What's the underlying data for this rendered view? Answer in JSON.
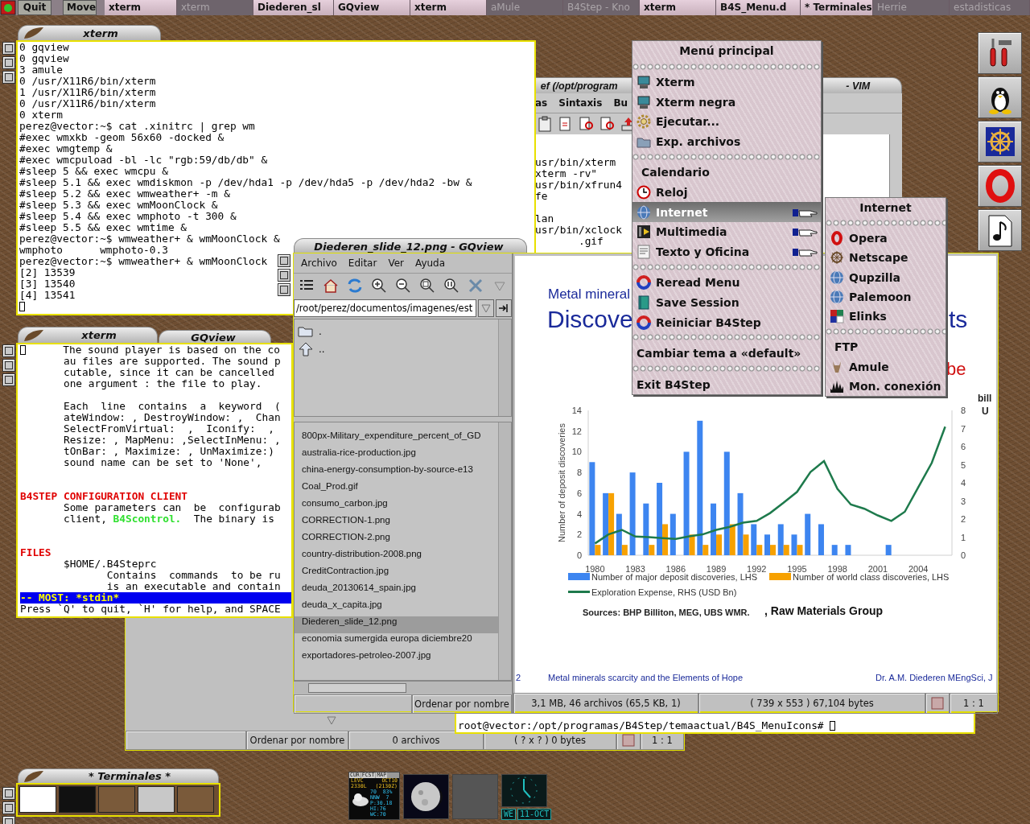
{
  "taskbar": {
    "buttons": [
      "Quit",
      "Move"
    ],
    "tasks": [
      {
        "label": "xterm",
        "iconified": false
      },
      {
        "label": "xterm",
        "iconified": true
      },
      {
        "label": "Diederen_sl",
        "iconified": false
      },
      {
        "label": "GQview",
        "iconified": false
      },
      {
        "label": "xterm",
        "iconified": false
      },
      {
        "label": "aMule",
        "iconified": true
      },
      {
        "label": "B4Step - Kno",
        "iconified": true
      },
      {
        "label": "xterm",
        "iconified": false
      },
      {
        "label": "B4S_Menu.d",
        "iconified": false
      },
      {
        "label": "* Terminales",
        "iconified": false
      },
      {
        "label": "Herrie",
        "iconified": true
      },
      {
        "label": "estadisticas",
        "iconified": true
      }
    ]
  },
  "vim_window": {
    "title_start": "ef (/opt/program",
    "title_end": "- VIM",
    "menu": [
      "as",
      "Sintaxis",
      "Bu"
    ],
    "lines": [
      {
        "kind": "blank"
      },
      {
        "kind": "blank"
      },
      {
        "kind": "text",
        "text": "usr/bin/xterm"
      },
      {
        "kind": "text",
        "text": "xterm -rv\""
      },
      {
        "kind": "text",
        "text": "usr/bin/xfrun4"
      },
      {
        "kind": "text",
        "text": "fe"
      },
      {
        "kind": "blank"
      },
      {
        "kind": "text",
        "text": "lan"
      },
      {
        "kind": "text",
        "text": "usr/bin/xclock"
      },
      {
        "kind": "text",
        "text": "       .gif"
      }
    ]
  },
  "terminal_top": {
    "title": "xterm",
    "lines": [
      {
        "kind": "text",
        "text": "0 gqview"
      },
      {
        "kind": "text",
        "text": "0 gqview"
      },
      {
        "kind": "text",
        "text": "3 amule"
      },
      {
        "kind": "text",
        "text": "0 /usr/X11R6/bin/xterm"
      },
      {
        "kind": "text",
        "text": "1 /usr/X11R6/bin/xterm"
      },
      {
        "kind": "text",
        "text": "0 /usr/X11R6/bin/xterm"
      },
      {
        "kind": "text",
        "text": "0 xterm"
      },
      {
        "kind": "text",
        "text": "perez@vector:~$ cat .xinitrc | grep wm"
      },
      {
        "kind": "text",
        "text": "#exec wmxkb -geom 56x60 -docked &"
      },
      {
        "kind": "text",
        "text": "#exec wmgtemp &"
      },
      {
        "kind": "text",
        "text": "#exec wmcpuload -bl -lc \"rgb:59/db/db\" &"
      },
      {
        "kind": "text",
        "text": "#sleep 5 && exec wmcpu &"
      },
      {
        "kind": "text",
        "text": "#sleep 5.1 && exec wmdiskmon -p /dev/hda1 -p /dev/hda5 -p /dev/hda2 -bw &"
      },
      {
        "kind": "text",
        "text": "#sleep 5.2 && exec wmweather+ -m &"
      },
      {
        "kind": "text",
        "text": "#sleep 5.3 && exec wmMoonClock &"
      },
      {
        "kind": "text",
        "text": "#sleep 5.4 && exec wmphoto -t 300 &"
      },
      {
        "kind": "text",
        "text": "#sleep 5.5 && exec wmtime &"
      },
      {
        "kind": "text",
        "text": "perez@vector:~$ wmweather+ & wmMoonClock &"
      },
      {
        "kind": "text",
        "text": "wmphoto      wmphoto-0.3"
      },
      {
        "kind": "text",
        "text": "perez@vector:~$ wmweather+ & wmMoonClock"
      },
      {
        "kind": "text",
        "text": "[2] 13539"
      },
      {
        "kind": "text",
        "text": "[3] 13540"
      },
      {
        "kind": "text",
        "text": "[4] 13541"
      },
      {
        "kind": "cursor"
      }
    ]
  },
  "gqview_back": {
    "title": "GQview",
    "status": [
      "Ordenar por nombre",
      "0 archivos",
      "( ? x ? ) 0 bytes",
      "1 : 1"
    ]
  },
  "terminal_man": {
    "title": "xterm",
    "lines": [
      {
        "kind": "cursor_text",
        "text": "      The sound player is based on the co"
      },
      {
        "kind": "text",
        "text": "       au files are supported. The sound p"
      },
      {
        "kind": "text",
        "text": "       cutable, since it can be cancelled"
      },
      {
        "kind": "text",
        "text": "       one argument : the file to play."
      },
      {
        "kind": "blank"
      },
      {
        "kind": "text",
        "text": "       Each  line  contains  a  keyword  ("
      },
      {
        "kind": "text",
        "text": "       ateWindow: , DestroyWindow: ,  Chan"
      },
      {
        "kind": "text",
        "text": "       SelectFromVirtual:  ,  Iconify:  ,"
      },
      {
        "kind": "text",
        "text": "       Resize: , MapMenu: ,SelectInMenu: ,"
      },
      {
        "kind": "text",
        "text": "       tOnBar: , Maximize: , UnMaximize:)"
      },
      {
        "kind": "text",
        "text": "       sound name can be set to 'None',"
      },
      {
        "kind": "blank"
      },
      {
        "kind": "blank"
      },
      {
        "kind": "heading",
        "text": "B4STEP CONFIGURATION CLIENT"
      },
      {
        "kind": "text",
        "text": "       Some parameters can  be  configurab"
      },
      {
        "kind": "mixed",
        "parts": [
          {
            "kind": "plain",
            "text": "       client, "
          },
          {
            "kind": "command",
            "text": "B4Scontrol."
          },
          {
            "kind": "plain",
            "text": "  The binary is"
          }
        ]
      },
      {
        "kind": "blank"
      },
      {
        "kind": "blank"
      },
      {
        "kind": "heading",
        "text": "FILES"
      },
      {
        "kind": "text",
        "text": "       $HOME/.B4Steprc"
      },
      {
        "kind": "text",
        "text": "              Contains  commands  to be ru"
      },
      {
        "kind": "text",
        "text": "              is an executable and contain"
      },
      {
        "kind": "status",
        "text": "-- MOST: *stdin*"
      },
      {
        "kind": "text",
        "text": "Press `Q' to quit, `H' for help, and SPACE"
      }
    ]
  },
  "terminal_bottom": {
    "lines": [
      {
        "kind": "prompt",
        "text": "root@vector:/opt/programas/B4Step/temaactual/B4S_MenuIcons# "
      }
    ]
  },
  "gqview": {
    "title": "Diederen_slide_12.png - GQview",
    "menu": [
      "Archivo",
      "Editar",
      "Ver",
      "Ayuda"
    ],
    "path": "/root/perez/documentos/imagenes/est",
    "folders": [
      ".",
      ".."
    ],
    "files": [
      {
        "name": "800px-Military_expenditure_percent_of_GD",
        "selected": false
      },
      {
        "name": "australia-rice-production.jpg",
        "selected": false
      },
      {
        "name": "china-energy-consumption-by-source-e13",
        "selected": false
      },
      {
        "name": "Coal_Prod.gif",
        "selected": false
      },
      {
        "name": "consumo_carbon.jpg",
        "selected": false
      },
      {
        "name": "CORRECTION-1.png",
        "selected": false
      },
      {
        "name": "CORRECTION-2.png",
        "selected": false
      },
      {
        "name": "country-distribution-2008.png",
        "selected": false
      },
      {
        "name": "CreditContraction.jpg",
        "selected": false
      },
      {
        "name": "deuda_20130614_spain.jpg",
        "selected": false
      },
      {
        "name": "deuda_x_capita.jpg",
        "selected": false
      },
      {
        "name": "Diederen_slide_12.png",
        "selected": true
      },
      {
        "name": "economia sumergida europa diciembre20",
        "selected": false
      },
      {
        "name": "exportadores-petroleo-2007.jpg",
        "selected": false
      }
    ],
    "sort": "Ordenar por nombre",
    "status": [
      "3,1 MB, 46 archivos (65,5 KB, 1)",
      "( 739 x 553 ) 67,104 bytes",
      "1 : 1"
    ],
    "slide": {
      "heading_small": "Metal mineral",
      "heading_large": "Discove",
      "heading_large_end": "ts",
      "subtitle_end": "be",
      "axis_unit": [
        "bill",
        "U"
      ],
      "chart_data": {
        "type": "bar",
        "ylabel": "Number of deposit discoveries",
        "x": [
          1980,
          1981,
          1982,
          1983,
          1984,
          1985,
          1986,
          1987,
          1988,
          1989,
          1990,
          1991,
          1992,
          1993,
          1994,
          1995,
          1996,
          1997,
          1998,
          1999,
          2000,
          2001,
          2002,
          2003,
          2004,
          2005,
          2006
        ],
        "xlim": [
          1979.5,
          2006.5
        ],
        "xticks": [
          1980,
          1983,
          1986,
          1989,
          1992,
          1995,
          1998,
          2001,
          2004
        ],
        "legend": "bottom",
        "ylim": [
          0,
          14
        ],
        "yticks": [
          0,
          2,
          4,
          6,
          8,
          10,
          12,
          14
        ],
        "y2lim": [
          0,
          8
        ],
        "y2ticks": [
          0,
          1,
          2,
          3,
          4,
          5,
          6,
          7,
          8
        ],
        "series": [
          {
            "name": "Number of major deposit discoveries, LHS",
            "color": "#3d85f0",
            "values": [
              9,
              6,
              4,
              8,
              5,
              7,
              4,
              10,
              13,
              5,
              10,
              6,
              3,
              2,
              3,
              2,
              4,
              3,
              1,
              1,
              0,
              0,
              1,
              0,
              0,
              0,
              0
            ]
          },
          {
            "name": "Number of world class discoveries, LHS",
            "color": "#f7a100",
            "values": [
              1,
              6,
              1,
              0,
              1,
              3,
              0,
              2,
              1,
              2,
              3,
              2,
              1,
              1,
              1,
              1,
              0,
              0,
              0,
              0,
              0,
              0,
              0,
              0,
              0,
              0,
              0
            ]
          },
          {
            "name": "Exploration Expense, RHS (USD Bn)",
            "color": "#1e7a4c",
            "type": "line",
            "axis": "y2",
            "values": [
              0.65,
              1.15,
              1.4,
              1.03,
              1.0,
              0.94,
              0.9,
              1.05,
              1.15,
              1.4,
              1.57,
              1.8,
              1.9,
              2.33,
              2.9,
              3.5,
              4.6,
              5.2,
              3.66,
              2.8,
              2.57,
              2.2,
              1.9,
              2.4,
              3.75,
              5.1,
              7.1
            ]
          }
        ]
      },
      "sources": "Sources: BHP Billiton, MEG, UBS WMR.",
      "sources_extra": ", Raw Materials Group",
      "footer": {
        "page": "2",
        "title": "Metal minerals scarcity and the Elements of Hope",
        "author": "Dr. A.M. Diederen MEngSci, J"
      }
    }
  },
  "main_menu": {
    "title": "Menú principal",
    "items": [
      {
        "kind": "item",
        "label": "Xterm",
        "selected": false,
        "submenu": false
      },
      {
        "kind": "item",
        "label": "Xterm negra",
        "selected": false,
        "submenu": false
      },
      {
        "kind": "item",
        "label": "Ejecutar...",
        "selected": false,
        "submenu": false
      },
      {
        "kind": "item",
        "label": "Exp. archivos",
        "selected": false,
        "submenu": false
      },
      {
        "kind": "separator"
      },
      {
        "kind": "heading",
        "label": "Calendario"
      },
      {
        "kind": "item",
        "label": "Reloj",
        "selected": false,
        "submenu": false
      },
      {
        "kind": "item",
        "label": "Internet",
        "selected": true,
        "submenu": true
      },
      {
        "kind": "item",
        "label": "Multimedia",
        "selected": false,
        "submenu": true
      },
      {
        "kind": "item",
        "label": "Texto y Oficina",
        "selected": false,
        "submenu": true
      },
      {
        "kind": "separator"
      },
      {
        "kind": "item",
        "label": "Reread Menu",
        "selected": false,
        "submenu": false
      },
      {
        "kind": "item",
        "label": "Save Session",
        "selected": false,
        "submenu": false
      },
      {
        "kind": "item",
        "label": "Reiniciar B4Step",
        "selected": false,
        "submenu": false
      },
      {
        "kind": "separator"
      },
      {
        "kind": "item",
        "label": "Cambiar tema a «default»",
        "selected": false,
        "submenu": false
      },
      {
        "kind": "separator"
      },
      {
        "kind": "item",
        "label": "Exit B4Step",
        "selected": false,
        "submenu": false
      }
    ]
  },
  "internet_menu": {
    "title": "Internet",
    "items": [
      {
        "kind": "item",
        "label": "Opera",
        "selected": false,
        "submenu": false
      },
      {
        "kind": "item",
        "label": "Netscape",
        "selected": false,
        "submenu": false
      },
      {
        "kind": "item",
        "label": "Qupzilla",
        "selected": false,
        "submenu": false
      },
      {
        "kind": "item",
        "label": "Palemoon",
        "selected": false,
        "submenu": false
      },
      {
        "kind": "item",
        "label": "Elinks",
        "selected": false,
        "submenu": false
      },
      {
        "kind": "separator"
      },
      {
        "kind": "heading",
        "label": "FTP"
      },
      {
        "kind": "item",
        "label": "Amule",
        "selected": false,
        "submenu": false
      },
      {
        "kind": "item",
        "label": "Mon. conexión",
        "selected": false,
        "submenu": false
      }
    ]
  },
  "pager": {
    "title": "* Terminales *"
  },
  "weather": {
    "tabs": [
      "CUR",
      "FCST",
      "MAP"
    ],
    "station": "LEVC",
    "date": "OCT10",
    "local_time": "2330L",
    "utc_time": "(2130Z)",
    "readings": [
      "70  83%",
      "NNW  7",
      "P:30.18",
      "HI:76",
      "WC:70"
    ]
  },
  "clock": {
    "day": "WE",
    "date": "11-OCT"
  }
}
